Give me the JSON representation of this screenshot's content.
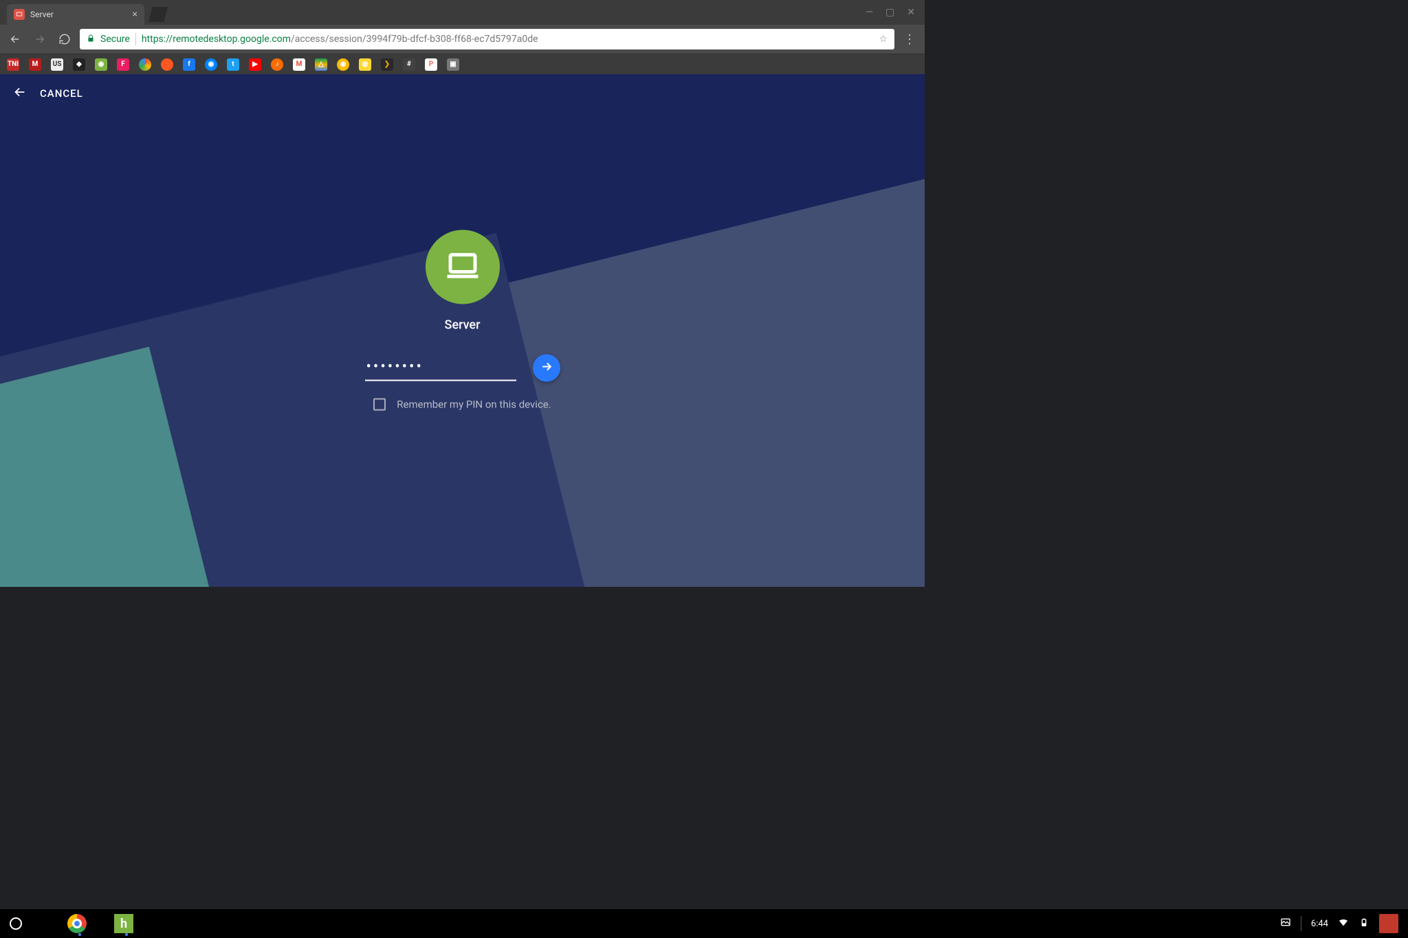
{
  "browser": {
    "tab_title": "Server",
    "secure_label": "Secure",
    "url_scheme": "https://",
    "url_domain": "remotedesktop.google.com",
    "url_path": "/access/session/3994f79b-dfcf-b308-ff68-ec7d5797a0de"
  },
  "app": {
    "cancel_label": "CANCEL",
    "device_name": "Server",
    "pin_value": "········",
    "remember_label": "Remember my PIN on this device."
  },
  "taskbar": {
    "time": "6:44",
    "hulu_letter": "h"
  }
}
